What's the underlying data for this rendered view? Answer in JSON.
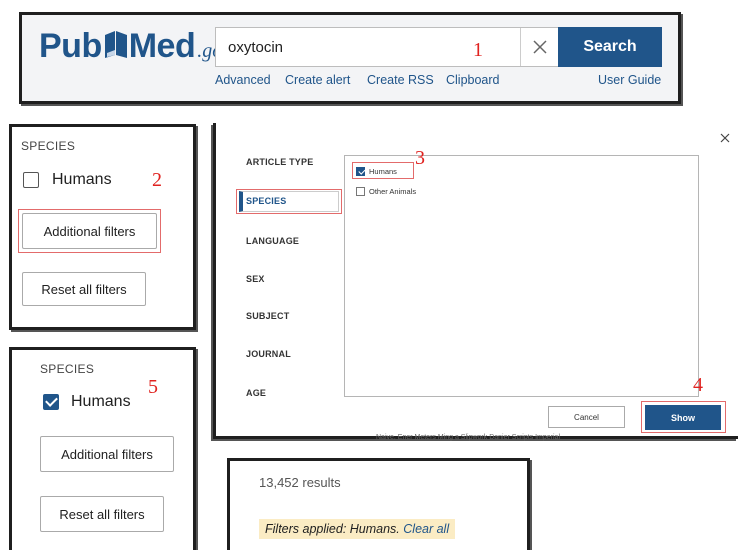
{
  "colors": {
    "brand": "#20558a",
    "annotation": "#e0221f",
    "highlight": "#fbecc4"
  },
  "steps": [
    "1",
    "2",
    "3",
    "4",
    "5"
  ],
  "header": {
    "logo": {
      "pub": "Pub",
      "med": "Med",
      "gov": ".gov",
      "icon": "book-icon"
    },
    "search": {
      "value": "oxytocin",
      "clear_icon": "close-icon",
      "button": "Search"
    },
    "links": [
      "Advanced",
      "Create alert",
      "Create RSS",
      "Clipboard"
    ],
    "user_guide": "User Guide"
  },
  "sidebar_before": {
    "heading": "SPECIES",
    "checkbox_label": "Humans",
    "checked": false,
    "additional_filters": "Additional filters",
    "reset": "Reset all filters"
  },
  "dialog": {
    "categories": [
      "ARTICLE TYPE",
      "SPECIES",
      "LANGUAGE",
      "SEX",
      "SUBJECT",
      "JOURNAL",
      "AGE"
    ],
    "selected_category": "SPECIES",
    "options": [
      {
        "label": "Humans",
        "checked": true
      },
      {
        "label": "Other Animals",
        "checked": false
      }
    ],
    "close_icon": "close-icon",
    "cancel": "Cancel",
    "show": "Show",
    "underlying_text": "Naive, Ener Meters Ming a Slipwork Danier Scripts Imperial"
  },
  "sidebar_after": {
    "heading": "SPECIES",
    "checkbox_label": "Humans",
    "checked": true,
    "additional_filters": "Additional filters",
    "reset": "Reset all filters"
  },
  "results": {
    "count": "13,452 results",
    "filters_prefix": "Filters applied: Humans.",
    "clear_all": "Clear all"
  }
}
